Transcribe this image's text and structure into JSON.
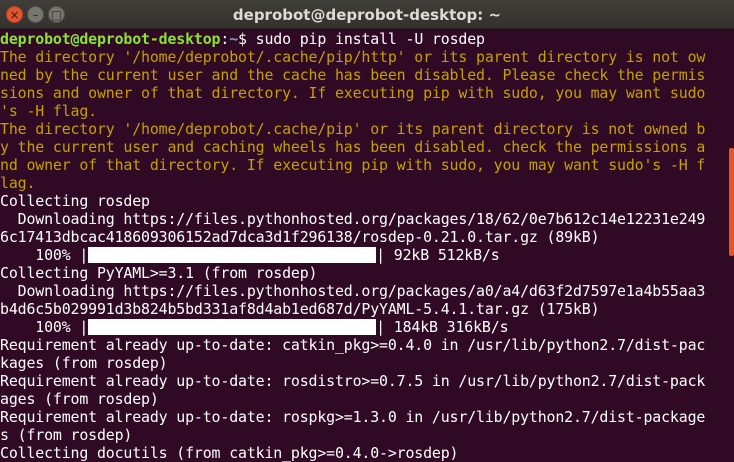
{
  "window": {
    "title": "deprobot@deprobot-desktop: ~"
  },
  "titlebar": {
    "close_glyph": "×",
    "min_glyph": "–",
    "max_glyph": "□"
  },
  "prompt": {
    "user_host": "deprobot@deprobot-desktop",
    "sep": ":",
    "path": "~",
    "symbol": "$ ",
    "command": "sudo pip install -U rosdep"
  },
  "warnings": [
    "The directory '/home/deprobot/.cache/pip/http' or its parent directory is not ow",
    "ned by the current user and the cache has been disabled. Please check the permis",
    "sions and owner of that directory. If executing pip with sudo, you may want sudo",
    "'s -H flag.",
    "The directory '/home/deprobot/.cache/pip' or its parent directory is not owned b",
    "y the current user and caching wheels has been disabled. check the permissions a",
    "nd owner of that directory. If executing pip with sudo, you may want sudo's -H f",
    "lag."
  ],
  "install1": {
    "collecting": "Collecting rosdep",
    "download": [
      "  Downloading https://files.pythonhosted.org/packages/18/62/0e7b612c14e12231e249",
      "6c17413dbcac418609306152ad7dca3d1f296138/rosdep-0.21.0.tar.gz (89kB)"
    ],
    "pct": "    100% |",
    "stats": "| 92kB 512kB/s",
    "progress": 1.0
  },
  "install2": {
    "collecting": "Collecting PyYAML>=3.1 (from rosdep)",
    "download": [
      "  Downloading https://files.pythonhosted.org/packages/a0/a4/d63f2d7597e1a4b55aa3",
      "b4d6c5b029991d3b824b5bd331af8d4ab1ed687d/PyYAML-5.4.1.tar.gz (175kB)"
    ],
    "pct": "    100% |",
    "stats": "| 184kB 316kB/s",
    "progress": 1.0
  },
  "requirements": [
    "Requirement already up-to-date: catkin_pkg>=0.4.0 in /usr/lib/python2.7/dist-pac",
    "kages (from rosdep)",
    "Requirement already up-to-date: rosdistro>=0.7.5 in /usr/lib/python2.7/dist-pack",
    "ages (from rosdep)",
    "Requirement already up-to-date: rospkg>=1.3.0 in /usr/lib/python2.7/dist-package",
    "s (from rosdep)",
    "Collecting docutils (from catkin_pkg>=0.4.0->rosdep)"
  ],
  "colors": {
    "background": "#300a24",
    "warning": "#c4a000",
    "user_host": "#8ae234",
    "path": "#729fcf",
    "scrollbar": "#e95420"
  }
}
